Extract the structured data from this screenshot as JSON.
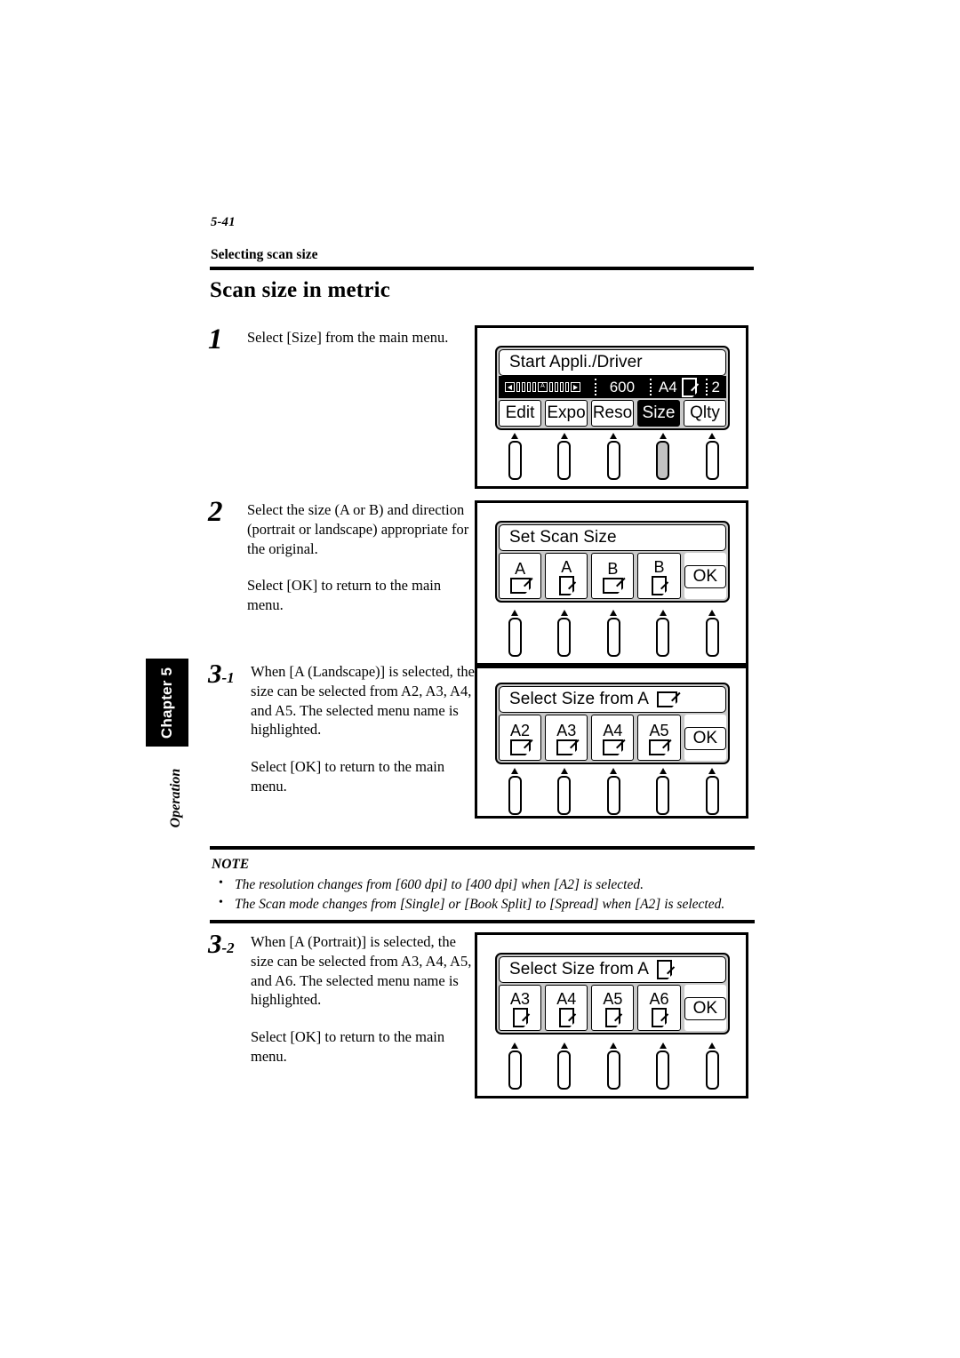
{
  "page": {
    "folio": "5-41",
    "running_head": "Selecting scan size",
    "section_title": "Scan size in metric"
  },
  "side_tab": {
    "chapter_label": "Chapter 5",
    "sub_label": "Operation"
  },
  "steps": [
    {
      "number": "1",
      "sub": "",
      "paragraphs": [
        "Select [Size] from the main menu."
      ]
    },
    {
      "number": "2",
      "sub": "",
      "paragraphs": [
        "Select the size (A or B) and direction (portrait or landscape) appropriate for the original.",
        "Select [OK] to return to the main menu."
      ]
    },
    {
      "number": "3",
      "sub": "-1",
      "paragraphs": [
        "When [A (Landscape)] is selected, the size can be selected from A2, A3, A4, and A5.  The selected menu name is highlighted.",
        "Select [OK] to return to the main menu."
      ]
    },
    {
      "number": "3",
      "sub": "-2",
      "paragraphs": [
        "When [A (Portrait)] is selected, the size can be selected from A3, A4, A5, and A6. The selected menu name is highlighted.",
        "Select [OK] to return to the main menu."
      ]
    }
  ],
  "note": {
    "title": "NOTE",
    "items": [
      "The resolution changes from [600 dpi] to [400 dpi] when [A2] is selected.",
      "The Scan mode changes from [Single] or [Book Split] to [Spread] when [A2] is selected."
    ]
  },
  "panels": [
    {
      "id": "panel-main-menu",
      "title": "Start Appli./Driver",
      "status": {
        "resolution": "600",
        "paper_size": "A4",
        "paper_orientation": "portrait",
        "count": "2",
        "gauge_center_label": "A",
        "gauge_ticks_left": 4,
        "gauge_ticks_right": 4
      },
      "keys": [
        {
          "label": "Edit",
          "selected": false
        },
        {
          "label": "Expo",
          "selected": false
        },
        {
          "label": "Reso",
          "selected": false
        },
        {
          "label": "Size",
          "selected": true
        },
        {
          "label": "Qlty",
          "selected": false
        }
      ],
      "buttons": [
        {
          "pressed": false
        },
        {
          "pressed": false
        },
        {
          "pressed": false
        },
        {
          "pressed": true
        },
        {
          "pressed": false
        }
      ]
    },
    {
      "id": "panel-set-scan-size",
      "title": "Set Scan Size",
      "keys": [
        {
          "label": "A",
          "glyph": "landscape",
          "selected": false
        },
        {
          "label": "A",
          "glyph": "portrait",
          "selected": false
        },
        {
          "label": "B",
          "glyph": "landscape",
          "selected": false
        },
        {
          "label": "B",
          "glyph": "portrait",
          "selected": false
        },
        {
          "label": "OK",
          "glyph": "none",
          "selected": false,
          "is_ok": true
        }
      ],
      "buttons": [
        {
          "pressed": false
        },
        {
          "pressed": false
        },
        {
          "pressed": false
        },
        {
          "pressed": false
        },
        {
          "pressed": false
        }
      ]
    },
    {
      "id": "panel-select-size-a-landscape",
      "title": "Select Size from A",
      "title_glyph": "landscape",
      "keys": [
        {
          "label": "A2",
          "glyph": "landscape",
          "selected": false
        },
        {
          "label": "A3",
          "glyph": "landscape",
          "selected": false
        },
        {
          "label": "A4",
          "glyph": "landscape",
          "selected": false
        },
        {
          "label": "A5",
          "glyph": "landscape",
          "selected": false
        },
        {
          "label": "OK",
          "glyph": "none",
          "selected": false,
          "is_ok": true
        }
      ],
      "buttons": [
        {
          "pressed": false
        },
        {
          "pressed": false
        },
        {
          "pressed": false
        },
        {
          "pressed": false
        },
        {
          "pressed": false
        }
      ]
    },
    {
      "id": "panel-select-size-a-portrait",
      "title": "Select Size from A",
      "title_glyph": "portrait",
      "keys": [
        {
          "label": "A3",
          "glyph": "portrait",
          "selected": false
        },
        {
          "label": "A4",
          "glyph": "portrait",
          "selected": false
        },
        {
          "label": "A5",
          "glyph": "portrait",
          "selected": false
        },
        {
          "label": "A6",
          "glyph": "portrait",
          "selected": false
        },
        {
          "label": "OK",
          "glyph": "none",
          "selected": false,
          "is_ok": true
        }
      ],
      "buttons": [
        {
          "pressed": false
        },
        {
          "pressed": false
        },
        {
          "pressed": false
        },
        {
          "pressed": false
        },
        {
          "pressed": false
        }
      ]
    }
  ],
  "colors": {
    "ink": "#000000",
    "paper": "#ffffff",
    "lcd_bezel": "#c9c9c9",
    "pressed_button": "#c2c2c2"
  }
}
